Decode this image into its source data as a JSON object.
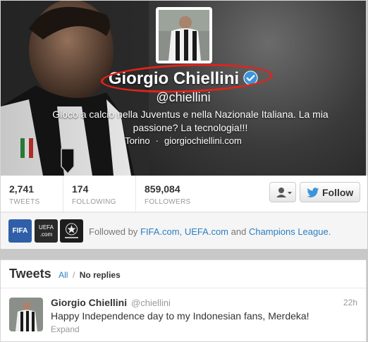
{
  "profile": {
    "display_name": "Giorgio Chiellini",
    "screen_name": "@chiellini",
    "bio": "Gioco a calcio nella Juventus e nella Nazionale Italiana. La mia passione? La tecnologia!!!",
    "location": "Torino",
    "location_separator": "·",
    "website": "giorgiochiellini.com",
    "verified_icon": "verified-badge-icon"
  },
  "stats": {
    "tweets": {
      "value": "2,741",
      "label": "TWEETS"
    },
    "following": {
      "value": "174",
      "label": "FOLLOWING"
    },
    "followers": {
      "value": "859,084",
      "label": "FOLLOWERS"
    }
  },
  "actions": {
    "user_menu_icon": "user-dropdown-icon",
    "follow_label": "Follow",
    "follow_icon": "twitter-bird-icon"
  },
  "followed_by": {
    "prefix": "Followed by",
    "accounts": [
      "FIFA.com",
      "UEFA.com",
      "Champions League"
    ],
    "sep1": ",",
    "and": "and",
    "end": ".",
    "avatar_fifa": "FIFA",
    "avatar_uefa": "UEFA",
    "avatar_uefa_sub": ".com"
  },
  "tweets": {
    "title": "Tweets",
    "filter_all": "All",
    "filter_sep": "/",
    "filter_noreplies": "No replies",
    "items": [
      {
        "name": "Giorgio Chiellini",
        "handle": "@chiellini",
        "time": "22h",
        "text": "Happy Independence day to my Indonesian fans, Merdeka!",
        "expand": "Expand"
      }
    ]
  },
  "colors": {
    "link": "#2a7dc2",
    "verified": "#3b94d9",
    "highlight": "#e2231a"
  }
}
